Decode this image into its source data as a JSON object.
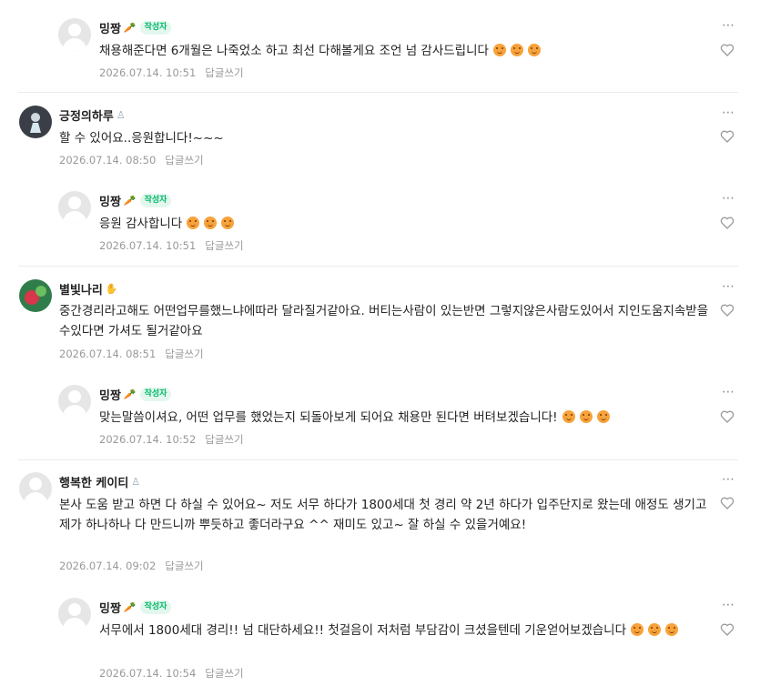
{
  "comments": [
    {
      "nickname": "밍짱",
      "author_tag": "작성자",
      "text": "채용해준다면 6개월은 나죽었소 하고 최선 다해볼게요 조언 넘 감사드립니다",
      "emojis": 3,
      "date": "2026.07.14. 10:51",
      "reply_label": "답글쓰기",
      "is_reply": true
    },
    {
      "nickname": "긍정의하루",
      "author_tag": "",
      "text": "할 수 있어요..응원합니다!~~~",
      "emojis": 0,
      "date": "2026.07.14. 08:50",
      "reply_label": "답글쓰기",
      "is_reply": false
    },
    {
      "nickname": "밍짱",
      "author_tag": "작성자",
      "text": "응원 감사합니다",
      "emojis": 3,
      "date": "2026.07.14. 10:51",
      "reply_label": "답글쓰기",
      "is_reply": true
    },
    {
      "nickname": "별빛나리",
      "author_tag": "",
      "text": "중간경리라고해도 어떤업무를했느냐에따라 달라질거같아요. 버티는사람이 있는반면 그렇지않은사람도있어서 지인도움지속받을수있다면 가셔도 될거같아요",
      "emojis": 0,
      "date": "2026.07.14. 08:51",
      "reply_label": "답글쓰기",
      "is_reply": false
    },
    {
      "nickname": "밍짱",
      "author_tag": "작성자",
      "text": "맞는말씀이셔요, 어떤 업무를 했었는지 되돌아보게 되어요 채용만 된다면 버텨보겠습니다!",
      "emojis": 3,
      "date": "2026.07.14. 10:52",
      "reply_label": "답글쓰기",
      "is_reply": true
    },
    {
      "nickname": "행복한 케이티",
      "author_tag": "",
      "text": "본사 도움 받고 하면 다 하실 수 있어요~ 저도 서무 하다가 1800세대 첫 경리 약 2년 하다가 입주단지로 왔는데 애정도 생기고 제가 하나하나 다 만드니까 뿌듯하고 좋더라구요 ^^ 재미도 있고~ 잘 하실 수 있을거예요!",
      "emojis": 0,
      "date": "2026.07.14. 09:02",
      "reply_label": "답글쓰기",
      "is_reply": false
    },
    {
      "nickname": "밍짱",
      "author_tag": "작성자",
      "text": "서무에서 1800세대 경리!! 넘 대단하세요!! 첫걸음이 저처럼 부담감이 크셨을텐데 기운얻어보겠습니다",
      "emojis": 3,
      "date": "2026.07.14. 10:54",
      "reply_label": "답글쓰기",
      "is_reply": true
    }
  ],
  "icons": {
    "more": "more-icon",
    "like": "heart-icon",
    "badge": "level-badge-icon"
  },
  "colors": {
    "author_tag_bg": "#e3f7ee",
    "author_tag_text": "#03b96a",
    "meta": "#999999",
    "divider": "#ebebeb"
  }
}
